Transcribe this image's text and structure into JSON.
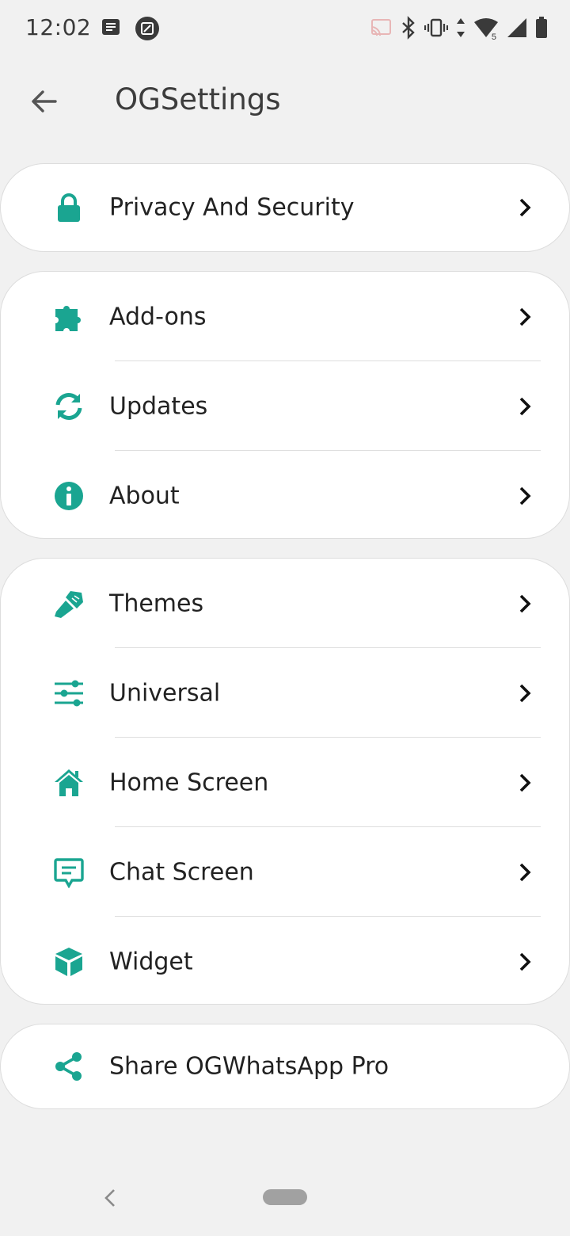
{
  "status_bar": {
    "time": "12:02",
    "left_icons": [
      "message-notification-icon",
      "screenshot-notification-icon"
    ],
    "right_icons": [
      "cast-icon",
      "bluetooth-icon",
      "vibrate-icon",
      "data-arrows-icon",
      "wifi-icon",
      "cell-signal-icon",
      "battery-icon"
    ],
    "wifi_badge": "5"
  },
  "toolbar": {
    "back_icon": "arrow-back-icon",
    "title": "OGSettings"
  },
  "accent_color": "#1aa591",
  "groups": [
    {
      "items": [
        {
          "label": "Privacy And Security",
          "icon": "lock-icon",
          "has_chevron": true
        }
      ]
    },
    {
      "items": [
        {
          "label": "Add-ons",
          "icon": "puzzle-icon",
          "has_chevron": true
        },
        {
          "label": "Updates",
          "icon": "sync-icon",
          "has_chevron": true
        },
        {
          "label": "About",
          "icon": "info-icon",
          "has_chevron": true
        }
      ]
    },
    {
      "items": [
        {
          "label": "Themes",
          "icon": "paint-brush-icon",
          "has_chevron": true
        },
        {
          "label": "Universal",
          "icon": "sliders-icon",
          "has_chevron": true
        },
        {
          "label": "Home Screen",
          "icon": "home-icon",
          "has_chevron": true
        },
        {
          "label": "Chat Screen",
          "icon": "chat-icon",
          "has_chevron": true
        },
        {
          "label": "Widget",
          "icon": "cube-icon",
          "has_chevron": true
        }
      ]
    },
    {
      "items": [
        {
          "label": "Share OGWhatsApp Pro",
          "icon": "share-icon",
          "has_chevron": false
        }
      ]
    }
  ],
  "nav_bar": {
    "back_icon": "nav-back-icon",
    "home_icon": "nav-home-pill"
  }
}
